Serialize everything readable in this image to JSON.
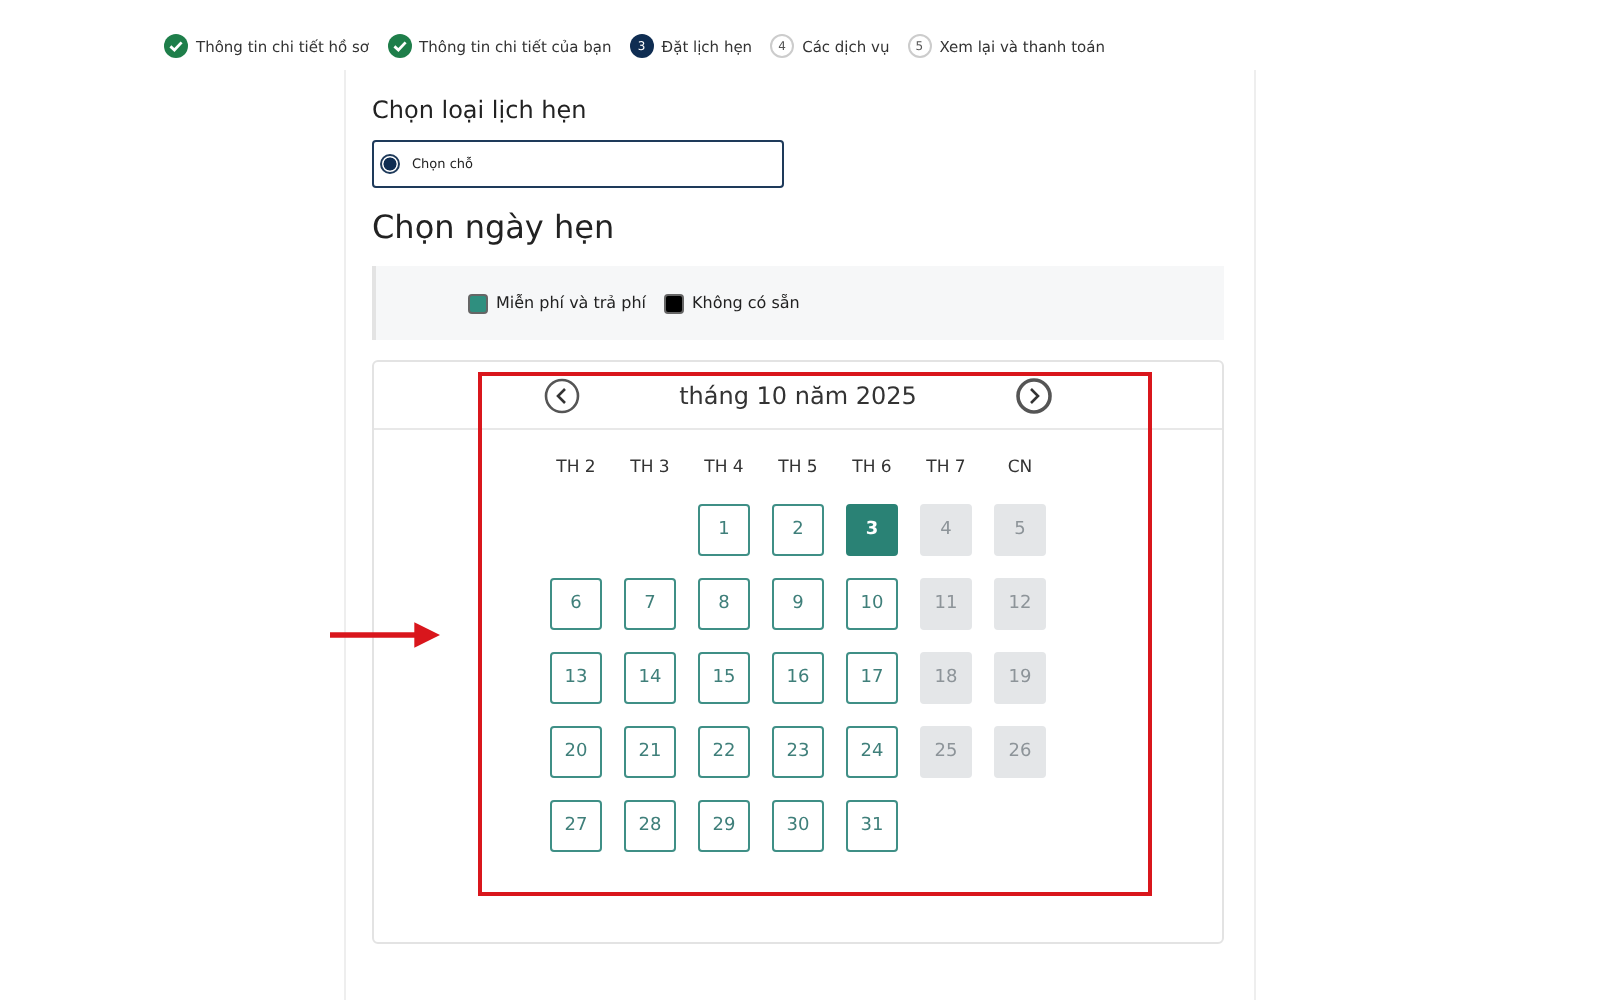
{
  "steps": [
    {
      "kind": "done",
      "label": "Thông tin chi tiết hồ sơ"
    },
    {
      "kind": "done",
      "label": "Thông tin chi tiết của bạn"
    },
    {
      "kind": "current",
      "number": "3",
      "label": "Đặt lịch hẹn"
    },
    {
      "kind": "upcoming",
      "number": "4",
      "label": "Các dịch vụ"
    },
    {
      "kind": "upcoming",
      "number": "5",
      "label": "Xem lại và thanh toán"
    }
  ],
  "appointment_type": {
    "heading": "Chọn loại lịch hẹn",
    "options": [
      {
        "label": "Chọn chỗ",
        "selected": true
      }
    ]
  },
  "date_section": {
    "heading": "Chọn ngày hẹn",
    "legend": [
      {
        "kind": "free",
        "label": "Miễn phí và trả phí"
      },
      {
        "kind": "unavailable",
        "label": "Không có sẵn"
      }
    ]
  },
  "calendar": {
    "month": "tháng 10 năm 2025",
    "weekdays": [
      "TH 2",
      "TH 3",
      "TH 4",
      "TH 5",
      "TH 6",
      "TH 7",
      "CN"
    ],
    "weeks": [
      [
        {
          "kind": "empty"
        },
        {
          "kind": "empty"
        },
        {
          "kind": "day",
          "label": "1",
          "selected": false,
          "disabled": false
        },
        {
          "kind": "day",
          "label": "2",
          "selected": false,
          "disabled": false
        },
        {
          "kind": "day",
          "label": "3",
          "selected": true,
          "disabled": false
        },
        {
          "kind": "day",
          "label": "4",
          "selected": false,
          "disabled": true
        },
        {
          "kind": "day",
          "label": "5",
          "selected": false,
          "disabled": true
        }
      ],
      [
        {
          "kind": "day",
          "label": "6",
          "selected": false,
          "disabled": false
        },
        {
          "kind": "day",
          "label": "7",
          "selected": false,
          "disabled": false
        },
        {
          "kind": "day",
          "label": "8",
          "selected": false,
          "disabled": false
        },
        {
          "kind": "day",
          "label": "9",
          "selected": false,
          "disabled": false
        },
        {
          "kind": "day",
          "label": "10",
          "selected": false,
          "disabled": false
        },
        {
          "kind": "day",
          "label": "11",
          "selected": false,
          "disabled": true
        },
        {
          "kind": "day",
          "label": "12",
          "selected": false,
          "disabled": true
        }
      ],
      [
        {
          "kind": "day",
          "label": "13",
          "selected": false,
          "disabled": false
        },
        {
          "kind": "day",
          "label": "14",
          "selected": false,
          "disabled": false
        },
        {
          "kind": "day",
          "label": "15",
          "selected": false,
          "disabled": false
        },
        {
          "kind": "day",
          "label": "16",
          "selected": false,
          "disabled": false
        },
        {
          "kind": "day",
          "label": "17",
          "selected": false,
          "disabled": false
        },
        {
          "kind": "day",
          "label": "18",
          "selected": false,
          "disabled": true
        },
        {
          "kind": "day",
          "label": "19",
          "selected": false,
          "disabled": true
        }
      ],
      [
        {
          "kind": "day",
          "label": "20",
          "selected": false,
          "disabled": false
        },
        {
          "kind": "day",
          "label": "21",
          "selected": false,
          "disabled": false
        },
        {
          "kind": "day",
          "label": "22",
          "selected": false,
          "disabled": false
        },
        {
          "kind": "day",
          "label": "23",
          "selected": false,
          "disabled": false
        },
        {
          "kind": "day",
          "label": "24",
          "selected": false,
          "disabled": false
        },
        {
          "kind": "day",
          "label": "25",
          "selected": false,
          "disabled": true
        },
        {
          "kind": "day",
          "label": "26",
          "selected": false,
          "disabled": true
        }
      ],
      [
        {
          "kind": "day",
          "label": "27",
          "selected": false,
          "disabled": false
        },
        {
          "kind": "day",
          "label": "28",
          "selected": false,
          "disabled": false
        },
        {
          "kind": "day",
          "label": "29",
          "selected": false,
          "disabled": false
        },
        {
          "kind": "day",
          "label": "30",
          "selected": false,
          "disabled": false
        },
        {
          "kind": "day",
          "label": "31",
          "selected": false,
          "disabled": false
        },
        {
          "kind": "empty"
        },
        {
          "kind": "empty"
        }
      ]
    ]
  }
}
